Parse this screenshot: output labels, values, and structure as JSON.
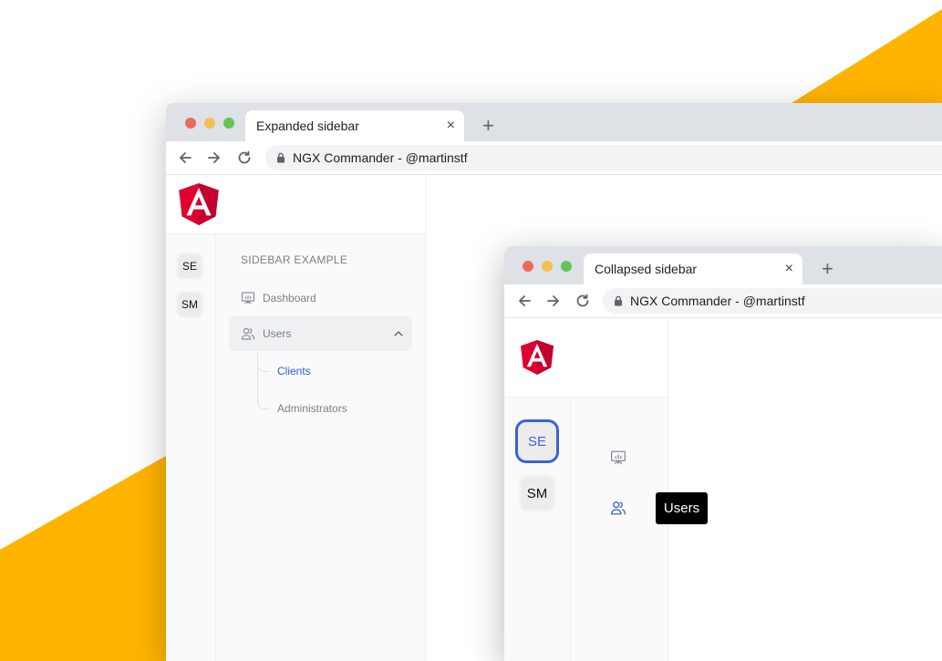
{
  "theme": {
    "accent": "#3a62d7",
    "background_shape": "#ffb400"
  },
  "expanded_window": {
    "tab_title": "Expanded sidebar",
    "close_glyph": "×",
    "new_tab_glyph": "+",
    "url": "NGX Commander - @martinstf",
    "workspaces": [
      "SE",
      "SM"
    ],
    "section_title": "SIDEBAR EXAMPLE",
    "nav": {
      "dashboard": {
        "label": "Dashboard",
        "icon": "presentation-chart-icon"
      },
      "users": {
        "label": "Users",
        "icon": "users-icon",
        "expanded": true
      },
      "children": [
        "Clients",
        "Administrators"
      ],
      "active_child": "Clients"
    }
  },
  "collapsed_window": {
    "tab_title": "Collapsed sidebar",
    "close_glyph": "×",
    "new_tab_glyph": "+",
    "url": "NGX Commander - @martinstf",
    "workspaces": [
      "SE",
      "SM"
    ],
    "active_workspace": "SE",
    "icons": [
      "presentation-chart-icon",
      "users-icon"
    ],
    "tooltip": "Users"
  }
}
